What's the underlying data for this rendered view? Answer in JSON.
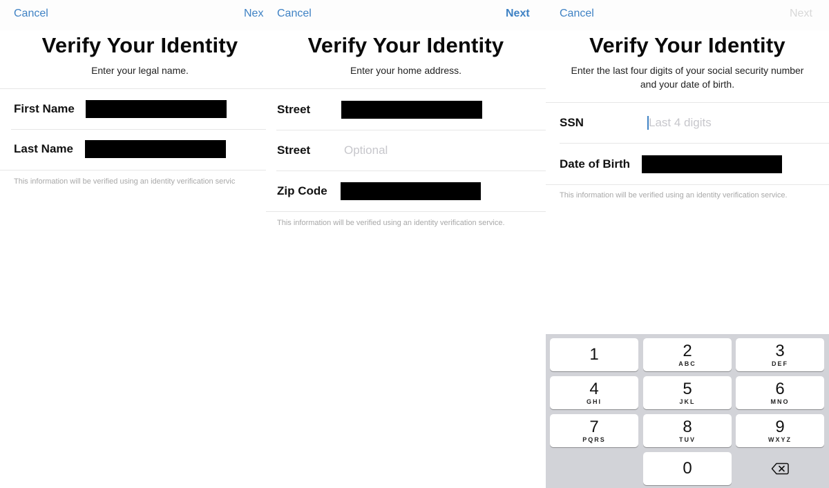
{
  "panels": [
    {
      "nav": {
        "cancel": "Cancel",
        "next": "Nex"
      },
      "title": "Verify Your Identity",
      "subtitle": "Enter your legal name.",
      "fields": [
        {
          "label": "First Name",
          "value": "[redacted]"
        },
        {
          "label": "Last Name",
          "value": "[redacted]"
        }
      ],
      "footnote": "This information will be verified using an identity verification servic"
    },
    {
      "nav": {
        "cancel": "Cancel",
        "next": "Next"
      },
      "title": "Verify Your Identity",
      "subtitle": "Enter your home address.",
      "fields": [
        {
          "label": "Street",
          "value": "[redacted]"
        },
        {
          "label": "Street",
          "placeholder": "Optional"
        },
        {
          "label": "Zip Code",
          "value": "[redacted]"
        }
      ],
      "footnote": "This information will be verified using an identity verification service."
    },
    {
      "nav": {
        "cancel": "Cancel",
        "next": "Next",
        "next_disabled": true
      },
      "title": "Verify Your Identity",
      "subtitle_line1": "Enter the last four digits of your social security number",
      "subtitle_line2": "and your date of birth.",
      "fields": [
        {
          "label": "SSN",
          "placeholder": "Last 4 digits"
        },
        {
          "label": "Date of Birth",
          "value": "[redacted]"
        }
      ],
      "footnote": "This information will be verified using an identity verification service."
    }
  ],
  "keypad": {
    "keys": [
      {
        "num": "1",
        "letters": ""
      },
      {
        "num": "2",
        "letters": "ABC"
      },
      {
        "num": "3",
        "letters": "DEF"
      },
      {
        "num": "4",
        "letters": "GHI"
      },
      {
        "num": "5",
        "letters": "JKL"
      },
      {
        "num": "6",
        "letters": "MNO"
      },
      {
        "num": "7",
        "letters": "PQRS"
      },
      {
        "num": "8",
        "letters": "TUV"
      },
      {
        "num": "9",
        "letters": "WXYZ"
      },
      {
        "num": "0",
        "letters": ""
      }
    ],
    "backspace_icon": "delete-backward-icon"
  },
  "colors": {
    "accent": "#3f82c4",
    "disabled": "#d8d8d8",
    "placeholder": "#c7c7cc",
    "keyboard_bg": "#d2d3d8"
  }
}
